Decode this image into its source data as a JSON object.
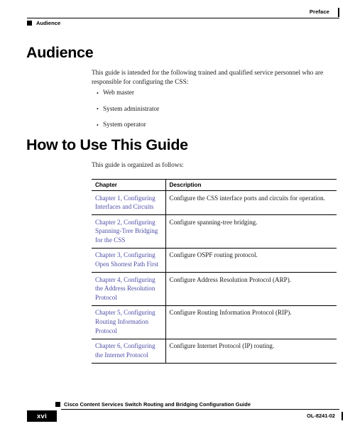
{
  "header": {
    "chapter_label": "Preface",
    "section_label": "Audience",
    "marker_icon": "black-square-icon"
  },
  "sections": [
    {
      "id": "audience",
      "title": "Audience",
      "paragraph": "This guide is intended for the following trained and qualified service personnel who are responsible for configuring the CSS:",
      "bullets": [
        "Web master",
        "System administrator",
        "System operator"
      ]
    },
    {
      "id": "how-to-use",
      "title": "How to Use This Guide",
      "paragraph": "This guide is organized as follows:"
    }
  ],
  "table": {
    "columns": [
      "Chapter",
      "Description"
    ],
    "rows": [
      {
        "chapter": "Chapter 1, Configuring Interfaces and Circuits",
        "description": "Configure the CSS interface ports and circuits for operation."
      },
      {
        "chapter": "Chapter 2, Configuring Spanning-Tree Bridging for the CSS",
        "description": "Configure spanning-tree bridging."
      },
      {
        "chapter": "Chapter 3, Configuring Open Shortest Path First",
        "description": "Configure OSPF routing protocol."
      },
      {
        "chapter": "Chapter 4, Configuring the Address Resolution Protocol",
        "description": "Configure Address Resolution Protocol (ARP)."
      },
      {
        "chapter": "Chapter 5, Configuring Routing Information Protocol",
        "description": "Configure Routing Information Protocol (RIP)."
      },
      {
        "chapter": "Chapter 6, Configuring the Internet Protocol",
        "description": "Configure Internet Protocol (IP) routing."
      }
    ],
    "link_color": "#4e4ea8"
  },
  "footer": {
    "document_title": "Cisco Content Services Switch Routing and Bridging Configuration Guide",
    "page_number": "xvi",
    "document_id": "OL-8241-02",
    "marker_icon": "black-square-icon"
  }
}
